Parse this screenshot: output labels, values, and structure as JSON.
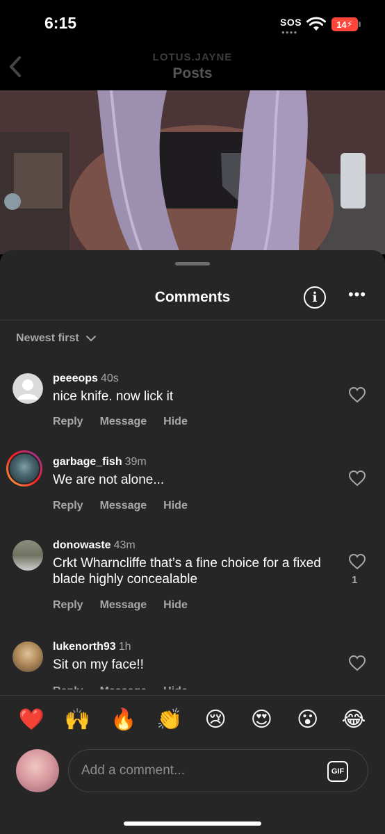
{
  "status": {
    "time": "6:15",
    "carrier": "SOS",
    "battery": "14"
  },
  "header": {
    "subtitle": "LOTUS.JAYNE",
    "title": "Posts"
  },
  "sheet": {
    "title": "Comments",
    "sort_label": "Newest first"
  },
  "comments": [
    {
      "user": "peeeops",
      "ago": "40s",
      "text": "nice knife. now lick it",
      "likes": ""
    },
    {
      "user": "garbage_fish",
      "ago": "39m",
      "text": "We are not alone...",
      "likes": ""
    },
    {
      "user": "donowaste",
      "ago": "43m",
      "text": "Crkt Wharncliffe that’s a fine choice for a fixed blade highly concealable",
      "likes": "1"
    },
    {
      "user": "lukenorth93",
      "ago": "1h",
      "text": "Sit on my face!!",
      "likes": ""
    }
  ],
  "actions": {
    "reply": "Reply",
    "message": "Message",
    "hide": "Hide"
  },
  "emojis": [
    "❤️",
    "🙌",
    "🔥",
    "👏",
    "😢",
    "😍",
    "😮",
    "😂"
  ],
  "composer": {
    "placeholder": "Add a comment...",
    "gif_label": "GIF"
  },
  "colors": {
    "accent_ring_start": "#fcb045",
    "accent_ring_end": "#833ab4",
    "battery_low": "#ff453a",
    "sheet_bg": "#262626"
  }
}
